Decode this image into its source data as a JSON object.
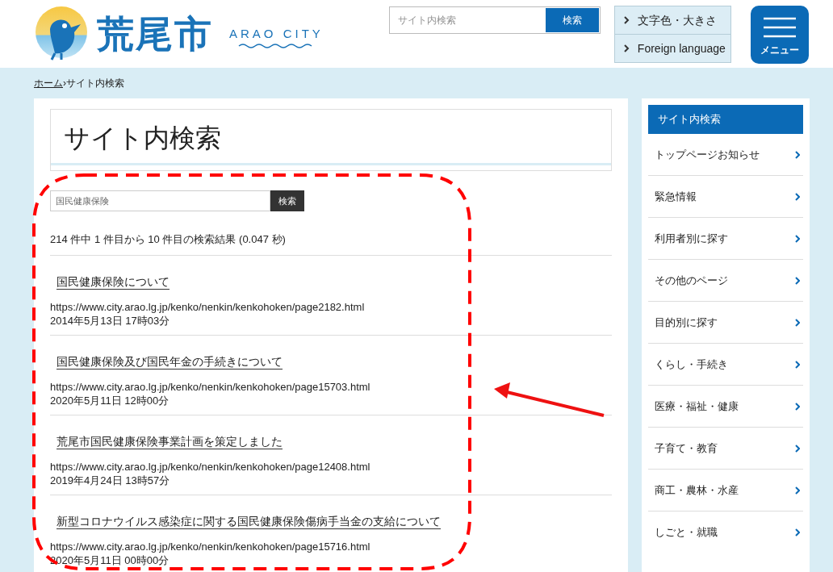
{
  "header": {
    "logo_text": "荒尾市",
    "logo_subtext": "ARAO CITY",
    "search": {
      "placeholder": "サイト内検索",
      "button": "検索"
    },
    "utility_links": [
      "文字色・大きさ",
      "Foreign language"
    ],
    "menu_button": "メニュー"
  },
  "breadcrumb": [
    {
      "label": "ホーム",
      "link": true
    },
    {
      "separator": "›"
    },
    {
      "label": "サイト内検索",
      "link": false
    }
  ],
  "page_title": "サイト内検索",
  "search": {
    "value": "国民健康保険",
    "button": "検索"
  },
  "result_summary": "214 件中 1 件目から 10 件目の検索結果 (0.047 秒)",
  "results": [
    {
      "title": "国民健康保険について",
      "url": "https://www.city.arao.lg.jp/kenko/nenkin/kenkohoken/page2182.html",
      "date": "2014年5月13日 17時03分"
    },
    {
      "title": "国民健康保険及び国民年金の手続きについて",
      "url": "https://www.city.arao.lg.jp/kenko/nenkin/kenkohoken/page15703.html",
      "date": "2020年5月11日 12時00分"
    },
    {
      "title": "荒尾市国民健康保険事業計画を策定しました",
      "url": "https://www.city.arao.lg.jp/kenko/nenkin/kenkohoken/page12408.html",
      "date": "2019年4月24日 13時57分"
    },
    {
      "title": "新型コロナウイルス感染症に関する国民健康保険傷病手当金の支給について",
      "url": "https://www.city.arao.lg.jp/kenko/nenkin/kenkohoken/page15716.html",
      "date": "2020年5月11日 00時00分"
    }
  ],
  "sidebar": {
    "heading": "サイト内検索",
    "items": [
      "トップページお知らせ",
      "緊急情報",
      "利用者別に探す",
      "その他のページ",
      "目的別に探す",
      "くらし・手続き",
      "医療・福祉・健康",
      "子育て・教育",
      "商工・農林・水産",
      "しごと・就職"
    ]
  }
}
